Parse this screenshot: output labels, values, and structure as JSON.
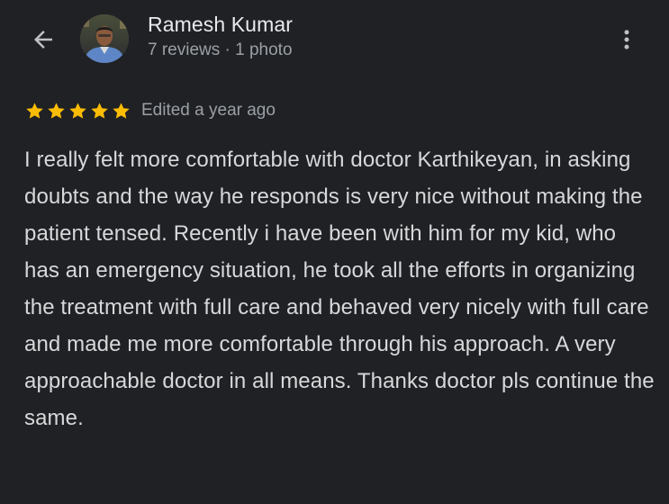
{
  "header": {
    "reviewer_name": "Ramesh Kumar",
    "reviewer_meta": "7 reviews · 1 photo",
    "back_icon": "arrow-back-icon",
    "more_icon": "more-vert-icon"
  },
  "review": {
    "rating": 5,
    "rating_max": 5,
    "edited_label": "Edited a year ago",
    "text": "I really felt more comfortable with doctor Karthikeyan, in asking doubts and the way he responds is very nice without making the patient tensed. Recently i have been with him for my kid, who has an emergency situation, he took all the efforts in organizing the treatment with full care and behaved very nicely with full care and made me more comfortable through his approach. A very approachable doctor in all means. Thanks doctor pls continue the same."
  },
  "colors": {
    "background": "#202124",
    "star": "#fbbc04",
    "primary_text": "#e8eaed",
    "secondary_text": "#9aa0a6",
    "body_text": "#d7d8da"
  }
}
